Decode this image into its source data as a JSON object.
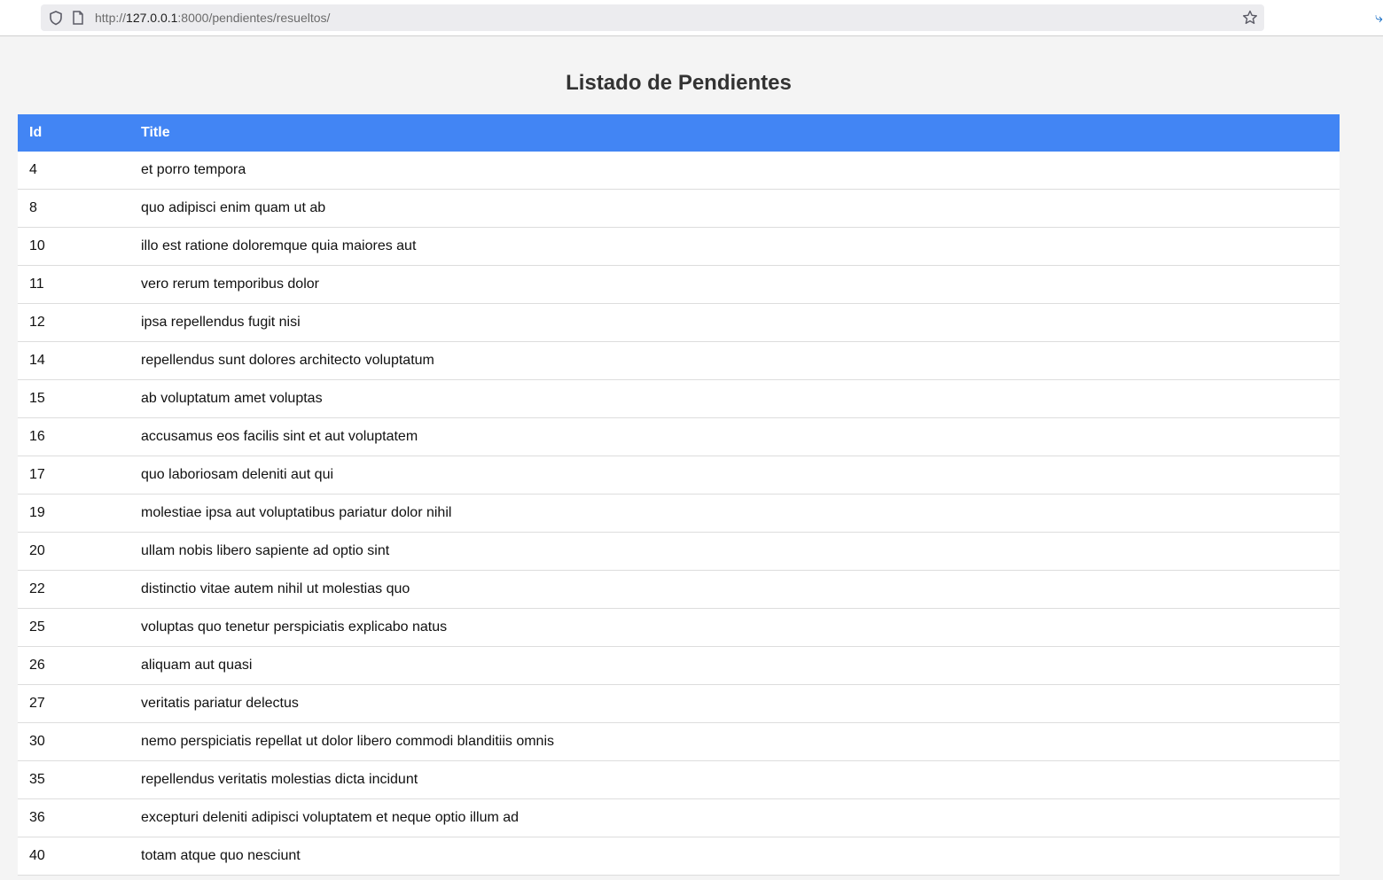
{
  "browser": {
    "url_prefix": "http://",
    "url_host": "127.0.0.1",
    "url_rest": ":8000/pendientes/resueltos/"
  },
  "page": {
    "title": "Listado de Pendientes"
  },
  "table": {
    "headers": [
      "Id",
      "Title"
    ],
    "rows": [
      {
        "id": "4",
        "title": "et porro tempora"
      },
      {
        "id": "8",
        "title": "quo adipisci enim quam ut ab"
      },
      {
        "id": "10",
        "title": "illo est ratione doloremque quia maiores aut"
      },
      {
        "id": "11",
        "title": "vero rerum temporibus dolor"
      },
      {
        "id": "12",
        "title": "ipsa repellendus fugit nisi"
      },
      {
        "id": "14",
        "title": "repellendus sunt dolores architecto voluptatum"
      },
      {
        "id": "15",
        "title": "ab voluptatum amet voluptas"
      },
      {
        "id": "16",
        "title": "accusamus eos facilis sint et aut voluptatem"
      },
      {
        "id": "17",
        "title": "quo laboriosam deleniti aut qui"
      },
      {
        "id": "19",
        "title": "molestiae ipsa aut voluptatibus pariatur dolor nihil"
      },
      {
        "id": "20",
        "title": "ullam nobis libero sapiente ad optio sint"
      },
      {
        "id": "22",
        "title": "distinctio vitae autem nihil ut molestias quo"
      },
      {
        "id": "25",
        "title": "voluptas quo tenetur perspiciatis explicabo natus"
      },
      {
        "id": "26",
        "title": "aliquam aut quasi"
      },
      {
        "id": "27",
        "title": "veritatis pariatur delectus"
      },
      {
        "id": "30",
        "title": "nemo perspiciatis repellat ut dolor libero commodi blanditiis omnis"
      },
      {
        "id": "35",
        "title": "repellendus veritatis molestias dicta incidunt"
      },
      {
        "id": "36",
        "title": "excepturi deleniti adipisci voluptatem et neque optio illum ad"
      },
      {
        "id": "40",
        "title": "totam atque quo nesciunt"
      }
    ]
  },
  "colors": {
    "header_bg": "#4285f4",
    "page_bg": "#f4f4f4"
  },
  "icons": [
    "shield-icon",
    "page-icon",
    "star-icon"
  ]
}
